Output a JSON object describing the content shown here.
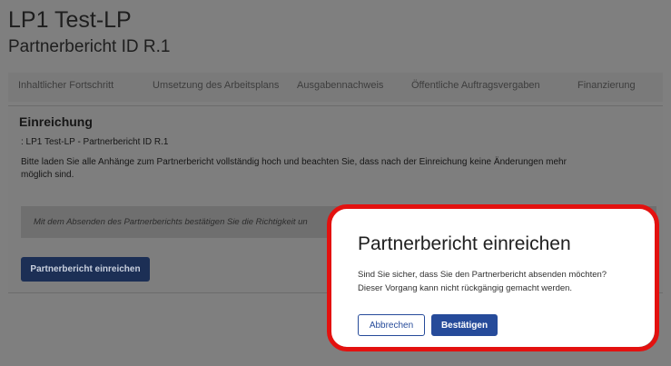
{
  "header": {
    "title": "LP1 Test-LP",
    "subtitle": "Partnerbericht ID R.1"
  },
  "tabs": [
    {
      "label": "Inhaltlicher Fortschritt"
    },
    {
      "label": "Umsetzung des Arbeitsplans"
    },
    {
      "label": "Ausgabennachweis"
    },
    {
      "label": "Öffentliche Auftragsvergaben"
    },
    {
      "label": "Finanzierung"
    }
  ],
  "submission": {
    "heading": "Einreichung",
    "reference": ": LP1 Test-LP - Partnerbericht ID R.1",
    "instructions": "Bitte laden Sie alle Anhänge zum Partnerbericht vollständig hoch und beachten Sie, dass nach der Einreichung keine Änderungen mehr möglich sind.",
    "notice": "Mit dem Absenden des Partnerberichts bestätigen Sie die Richtigkeit un",
    "submit_label": "Partnerbericht einreichen"
  },
  "dialog": {
    "title": "Partnerbericht einreichen",
    "line1": "Sind Sie sicher, dass Sie den Partnerbericht absenden möchten?",
    "line2": "Dieser Vorgang kann nicht rückgängig gemacht werden.",
    "cancel_label": "Abbrechen",
    "confirm_label": "Bestätigen"
  },
  "colors": {
    "highlight": "#e3110f",
    "primary": "#264b9a",
    "overlay": "#7f7f7f"
  }
}
